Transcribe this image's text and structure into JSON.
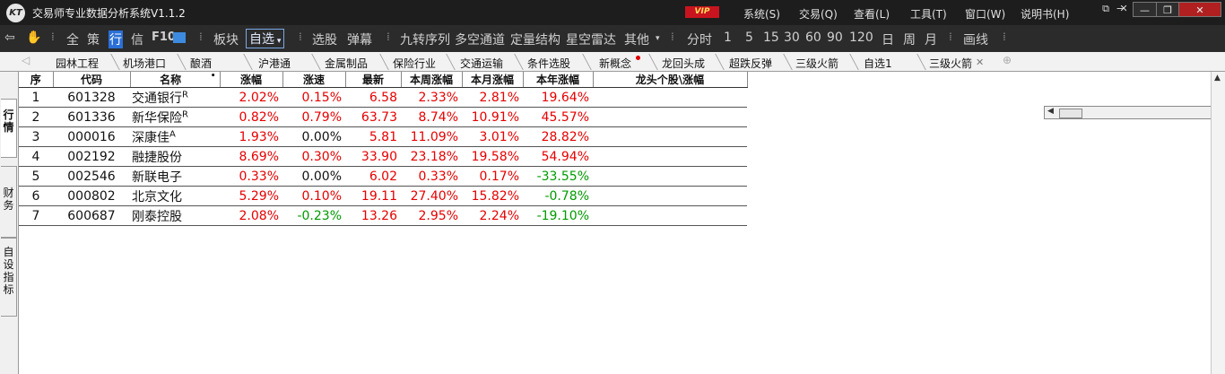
{
  "titlebar": {
    "logo": "KT",
    "title": "交易师专业数据分析系统V1.1.2",
    "vip": "VIP",
    "menus": [
      "系统(S)",
      "交易(Q)",
      "查看(L)",
      "工具(T)",
      "窗口(W)",
      "说明书(H)"
    ],
    "small_controls": [
      "⧉",
      "−",
      "✕"
    ],
    "window_buttons": [
      "—",
      "❐",
      "✕"
    ]
  },
  "toolbar": {
    "left_icons": [
      "⇦",
      "✋"
    ],
    "items_a": [
      "全",
      "策"
    ],
    "hang": "行",
    "xin": "信",
    "f10": "F10",
    "bankuai": "板块",
    "zixuan": "自选",
    "xuangu": "选股",
    "danmu": "弹幕",
    "tools": [
      "九转序列",
      "多空通道",
      "定量结构",
      "星空雷达",
      "其他"
    ],
    "periods": [
      "分时",
      "1",
      "5",
      "15",
      "30",
      "60",
      "90",
      "120",
      "日",
      "周",
      "月"
    ],
    "draw": "画线"
  },
  "tabs": [
    "园林工程",
    "机场港口",
    "酿酒",
    "沪港通",
    "金属制品",
    "保险行业",
    "交通运输",
    "条件选股",
    "新概念",
    "龙回头成",
    "超跌反弹",
    "三级火箭",
    "自选1",
    "三级火箭"
  ],
  "sidebar": {
    "hangqing": "行情",
    "caiwu": "财务",
    "zishe": "自设指标"
  },
  "table": {
    "headers": [
      "序",
      "代码",
      "名称",
      "涨幅",
      "涨速",
      "最新",
      "本周涨幅",
      "本月涨幅",
      "本年涨幅",
      "龙头个股\\涨幅"
    ],
    "sort_mark": "•",
    "rows": [
      {
        "seq": "1",
        "code": "601328",
        "name": "交通银行",
        "tag": "R",
        "chg": "2.02%",
        "speed": "0.15%",
        "last": "6.58",
        "week": "2.33%",
        "month": "2.81%",
        "year": "19.64%"
      },
      {
        "seq": "2",
        "code": "601336",
        "name": "新华保险",
        "tag": "R",
        "chg": "0.82%",
        "speed": "0.79%",
        "last": "63.73",
        "week": "8.74%",
        "month": "10.91%",
        "year": "45.57%"
      },
      {
        "seq": "3",
        "code": "000016",
        "name": "深康佳",
        "tag": "A",
        "chg": "1.93%",
        "speed": "0.00%",
        "last": "5.81",
        "week": "11.09%",
        "month": "3.01%",
        "year": "28.82%"
      },
      {
        "seq": "4",
        "code": "002192",
        "name": "融捷股份",
        "tag": "",
        "chg": "8.69%",
        "speed": "0.30%",
        "last": "33.90",
        "week": "23.18%",
        "month": "19.58%",
        "year": "54.94%"
      },
      {
        "seq": "5",
        "code": "002546",
        "name": "新联电子",
        "tag": "",
        "chg": "0.33%",
        "speed": "0.00%",
        "last": "6.02",
        "week": "0.33%",
        "month": "0.17%",
        "year": "-33.55%"
      },
      {
        "seq": "6",
        "code": "000802",
        "name": "北京文化",
        "tag": "",
        "chg": "5.29%",
        "speed": "0.10%",
        "last": "19.11",
        "week": "27.40%",
        "month": "15.82%",
        "year": "-0.78%"
      },
      {
        "seq": "7",
        "code": "600687",
        "name": "刚泰控股",
        "tag": "",
        "chg": "2.08%",
        "speed": "-0.23%",
        "last": "13.26",
        "week": "2.95%",
        "month": "2.24%",
        "year": "-19.10%"
      }
    ]
  },
  "colors": {
    "up": "#e60000",
    "down": "#009b00",
    "flat": "#111111"
  }
}
